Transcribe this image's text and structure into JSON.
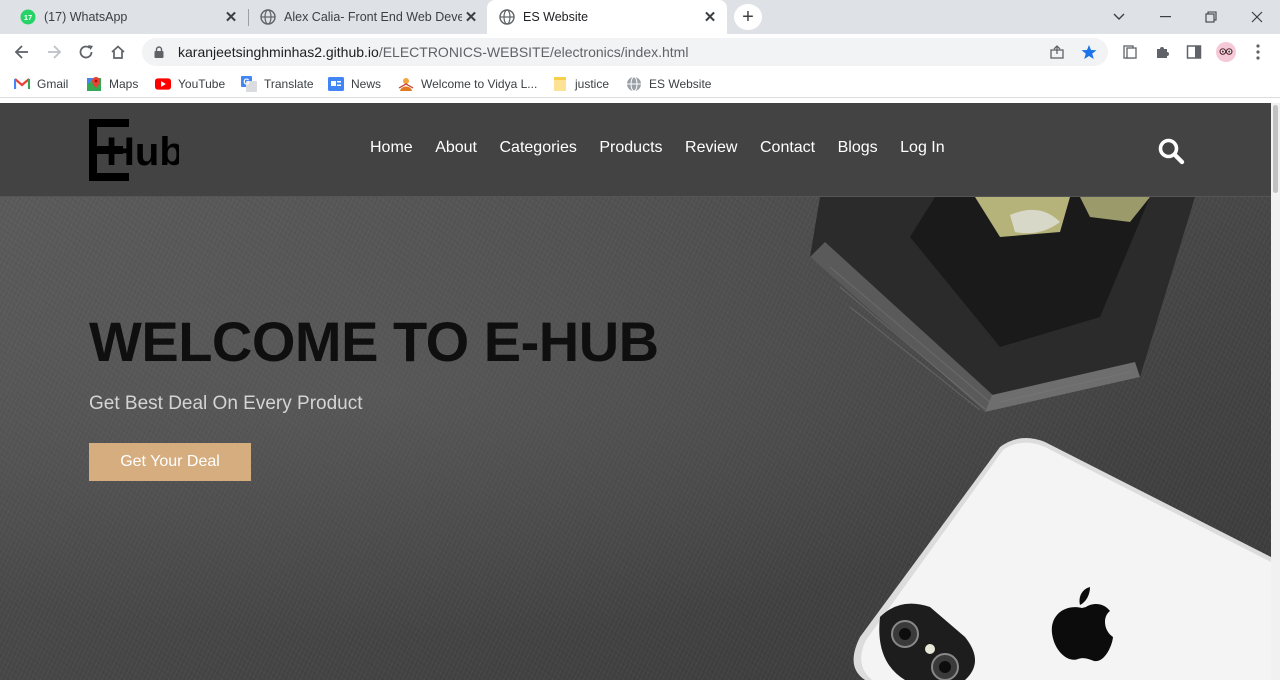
{
  "browser": {
    "tabs": [
      {
        "title": "(17) WhatsApp",
        "badge": "17"
      },
      {
        "title": "Alex Calia- Front End Web Develo"
      },
      {
        "title": "ES Website"
      }
    ],
    "url_host": "karanjeetsinghminhas2.github.io",
    "url_path": "/ELECTRONICS-WEBSITE/electronics/index.html",
    "bookmarks": [
      {
        "label": "Gmail"
      },
      {
        "label": "Maps"
      },
      {
        "label": "YouTube"
      },
      {
        "label": "Translate"
      },
      {
        "label": "News"
      },
      {
        "label": "Welcome to Vidya L..."
      },
      {
        "label": "justice"
      },
      {
        "label": "ES Website"
      }
    ]
  },
  "site": {
    "logo_text": "Hub",
    "nav": [
      "Home",
      "About",
      "Categories",
      "Products",
      "Review",
      "Contact",
      "Blogs",
      "Log In"
    ],
    "hero": {
      "title": "WELCOME TO E-HUB",
      "subtitle": "Get Best Deal On Every Product",
      "cta": "Get Your Deal"
    },
    "colors": {
      "header_bg": "#434343",
      "cta_bg": "#d6ad7f",
      "hero_bg": "#4a4a4a"
    }
  }
}
